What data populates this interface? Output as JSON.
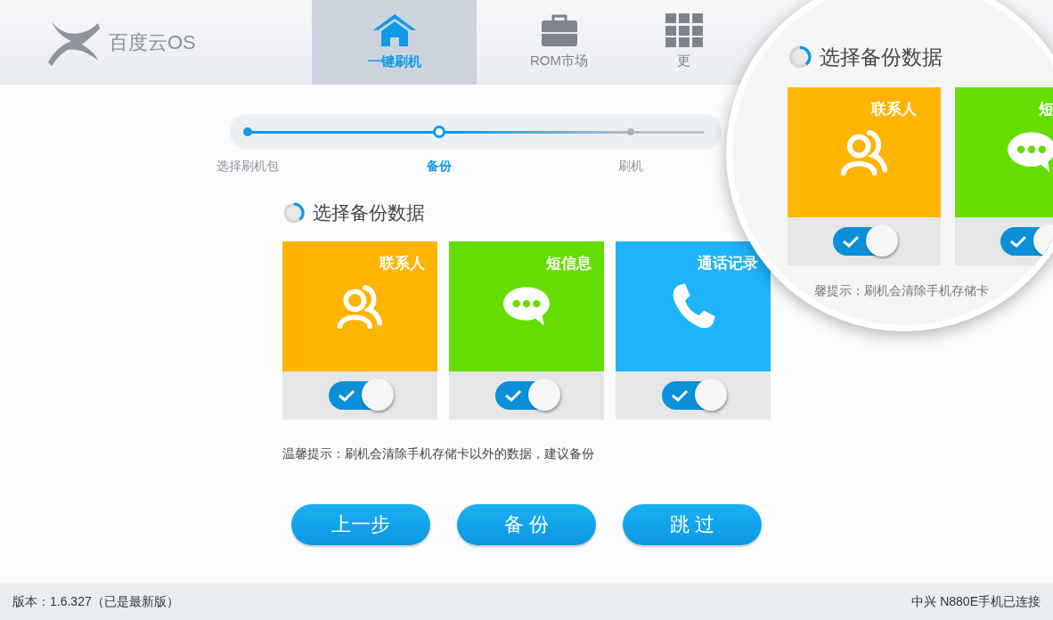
{
  "app": {
    "logo_text": "百度云OS"
  },
  "nav_tabs": [
    {
      "label": "一键刷机",
      "selected": true
    },
    {
      "label": "ROM市场",
      "selected": false
    },
    {
      "label": "更",
      "selected": false
    }
  ],
  "steps": [
    {
      "label": "选择刷机包",
      "selected": false
    },
    {
      "label": "备份",
      "selected": true
    },
    {
      "label": "刷机",
      "selected": false
    }
  ],
  "section_title": "选择备份数据",
  "backup_items": [
    {
      "label": "联系人",
      "color": "#ffb400",
      "checked": true
    },
    {
      "label": "短信息",
      "color": "#66dd00",
      "checked": true
    },
    {
      "label": "通话记录",
      "color": "#1eb4fb",
      "checked": true
    }
  ],
  "tip": "温馨提示：刷机会清除手机存储卡以外的数据，建议备份",
  "buttons": [
    "上一步",
    "备 份",
    "跳 过"
  ],
  "magnifier": {
    "section_title": "选择备份数据",
    "items": [
      {
        "label": "联系人",
        "color": "#ffb400",
        "checked": true
      },
      {
        "label": "短",
        "color": "#66dd00",
        "checked": true
      }
    ],
    "tip": "馨提示：刷机会清除手机存储卡"
  },
  "status_bar": {
    "version": "版本：1.6.327（已是最新版）",
    "device": "中兴 N880E手机已连接"
  }
}
